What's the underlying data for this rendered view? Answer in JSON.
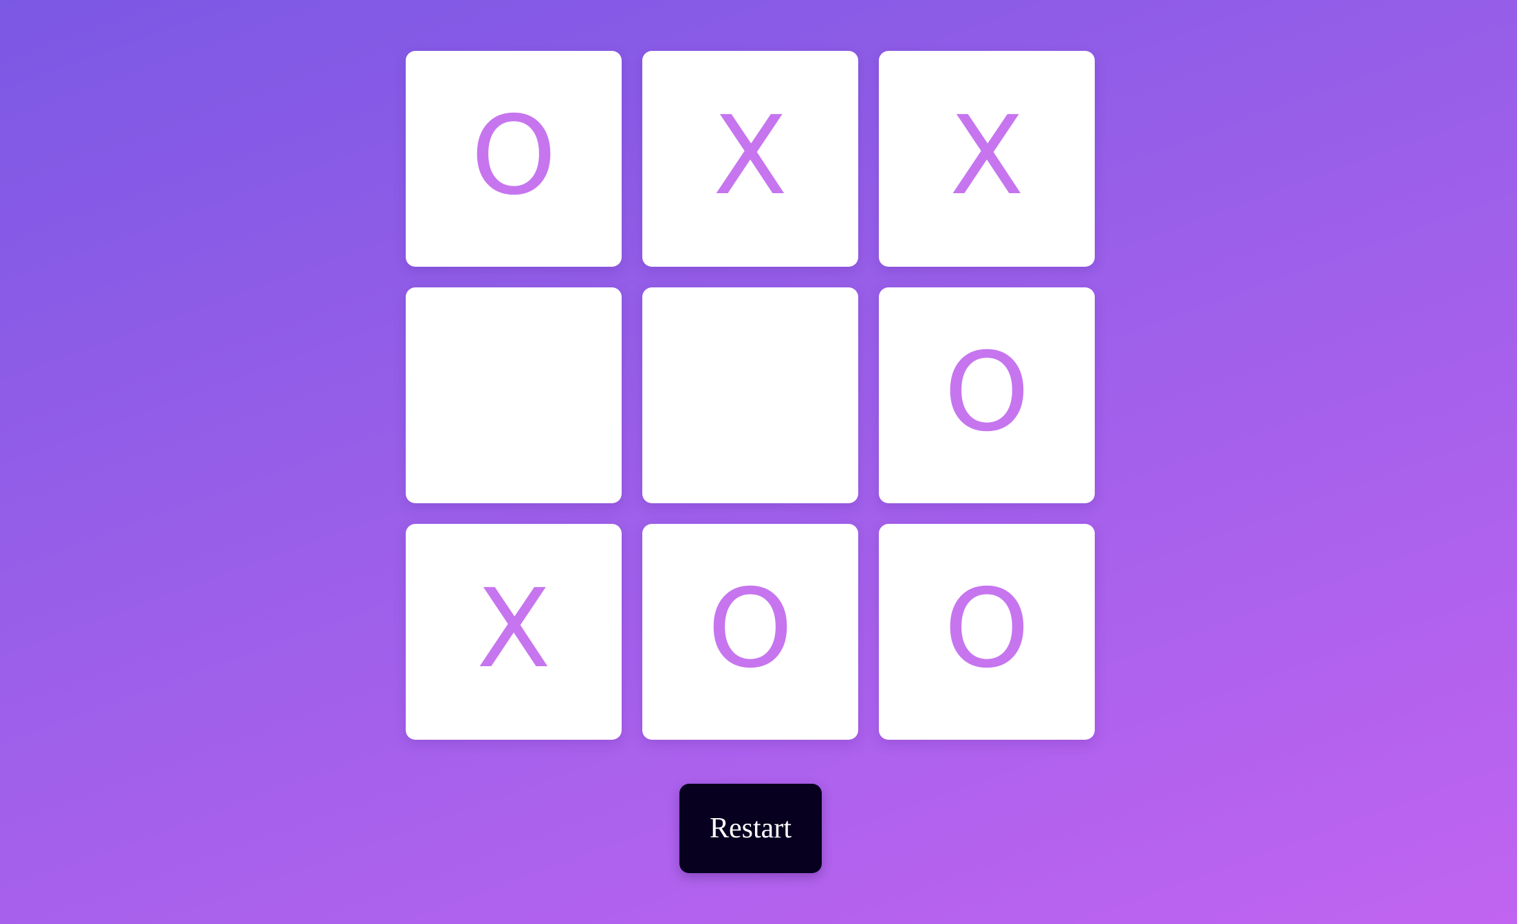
{
  "game": {
    "board": [
      [
        "O",
        "X",
        "X"
      ],
      [
        "",
        "",
        "O"
      ],
      [
        "X",
        "O",
        "O"
      ]
    ],
    "cells": [
      "O",
      "X",
      "X",
      "",
      "",
      "O",
      "X",
      "O",
      "O"
    ]
  },
  "controls": {
    "restart_label": "Restart"
  },
  "colors": {
    "background_start": "#7b58e4",
    "background_end": "#c064f1",
    "cell_background": "#ffffff",
    "mark_color": "#c675ef",
    "button_background": "#07001f",
    "button_text": "#ffffff"
  }
}
